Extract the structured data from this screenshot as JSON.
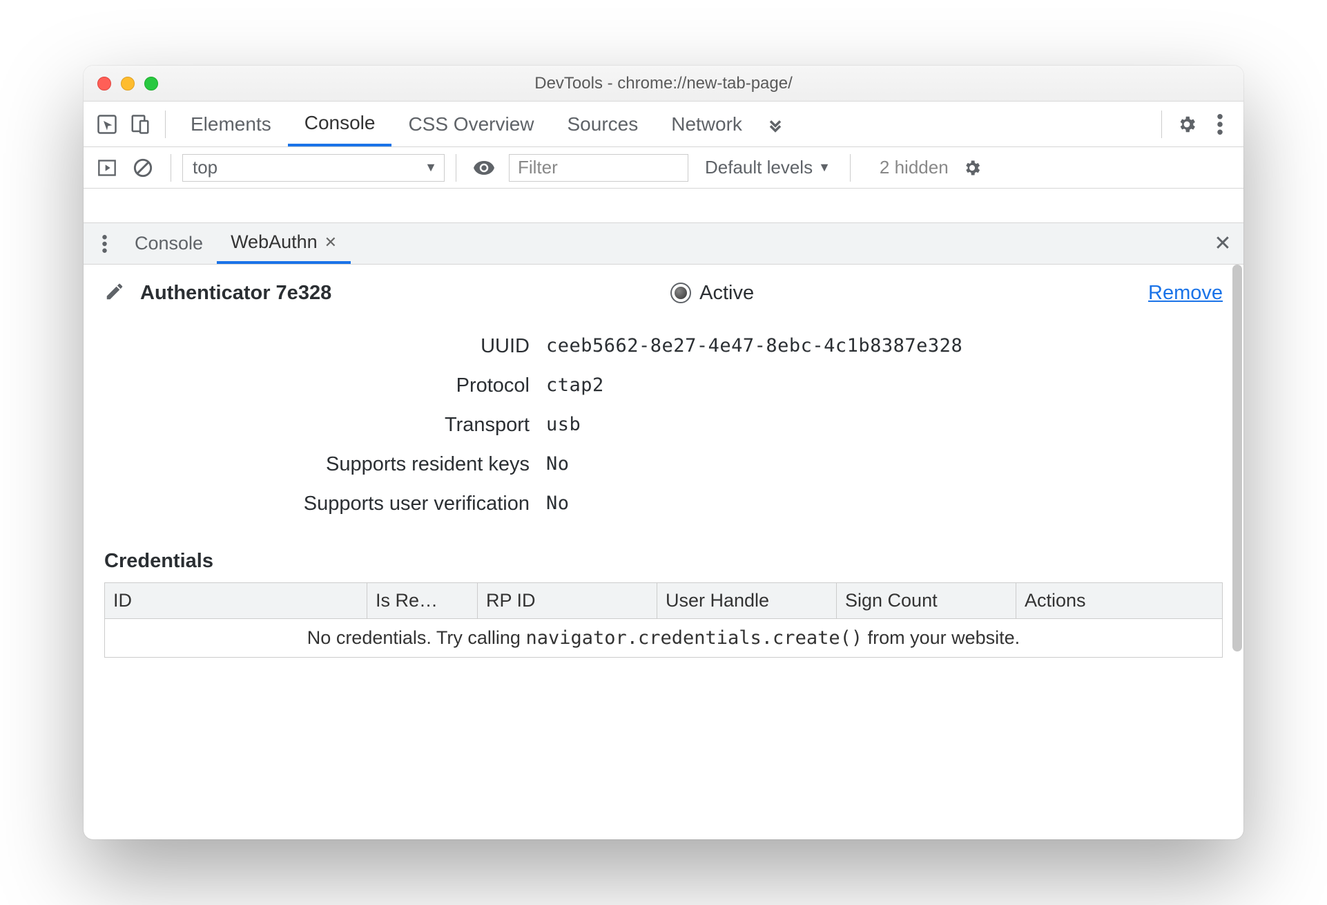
{
  "window": {
    "title": "DevTools - chrome://new-tab-page/"
  },
  "toprow": {
    "tabs": [
      "Elements",
      "Console",
      "CSS Overview",
      "Sources",
      "Network"
    ],
    "active": "Console"
  },
  "console_toolbar": {
    "context": "top",
    "filter_placeholder": "Filter",
    "levels": "Default levels",
    "hidden": "2 hidden"
  },
  "drawer": {
    "tabs": [
      "Console",
      "WebAuthn"
    ],
    "active": "WebAuthn"
  },
  "authenticator": {
    "name": "Authenticator 7e328",
    "active_label": "Active",
    "remove": "Remove",
    "props": {
      "uuid_label": "UUID",
      "uuid": "ceeb5662-8e27-4e47-8ebc-4c1b8387e328",
      "protocol_label": "Protocol",
      "protocol": "ctap2",
      "transport_label": "Transport",
      "transport": "usb",
      "resident_label": "Supports resident keys",
      "resident": "No",
      "userverif_label": "Supports user verification",
      "userverif": "No"
    }
  },
  "credentials": {
    "title": "Credentials",
    "columns": [
      "ID",
      "Is Re…",
      "RP ID",
      "User Handle",
      "Sign Count",
      "Actions"
    ],
    "empty_prefix": "No credentials. Try calling ",
    "empty_code": "navigator.credentials.create()",
    "empty_suffix": " from your website."
  }
}
